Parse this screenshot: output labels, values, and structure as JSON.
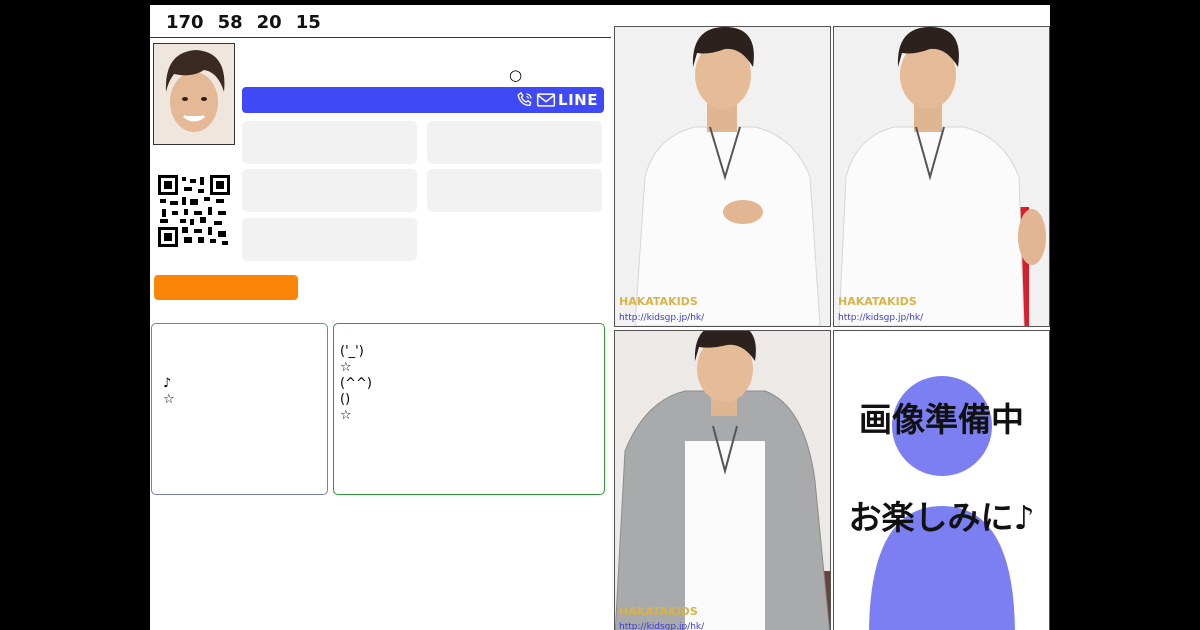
{
  "profile": {
    "stats": [
      "170",
      "58",
      "20",
      "15"
    ],
    "circle_mark": "○"
  },
  "contact": {
    "line_label": "LINE",
    "icons": [
      "phone-icon",
      "mail-icon"
    ],
    "bar_color": "#3f49f5"
  },
  "buttons": {
    "orange_color": "#fb8506"
  },
  "cards": {
    "blue_card": {
      "lines": [
        "♪",
        "☆"
      ]
    },
    "green_card": {
      "lines": [
        "('_')",
        "☆",
        "(^^)",
        "()",
        "☆"
      ]
    }
  },
  "gallery": {
    "watermark": "HAKATAKIDS",
    "watermark_url": "http://kidsgp.jp/hk/",
    "placeholder_text1": "画像準備中",
    "placeholder_text2": "お楽しみに♪",
    "placeholder_color": "#7b7ff2"
  }
}
